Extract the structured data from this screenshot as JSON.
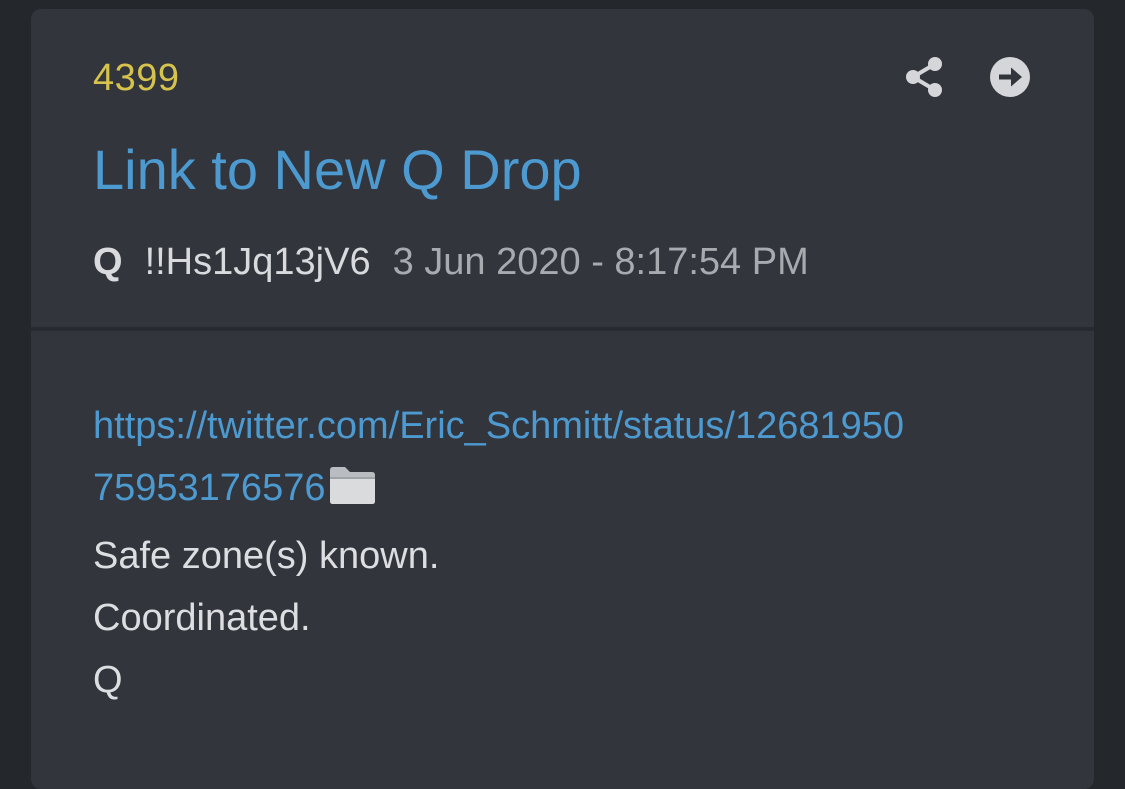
{
  "post": {
    "number": "4399",
    "title": "Link to New Q Drop",
    "author": "Q",
    "tripcode": "!!Hs1Jq13jV6",
    "date": "3 Jun 2020 - 8:17:54 PM",
    "link_line1": "https://twitter.com/Eric_Schmitt/status/12681950",
    "link_line2": "75953176576",
    "lines": [
      "Safe zone(s) known.",
      "Coordinated.",
      "Q"
    ]
  },
  "icons": {
    "share": "share-icon",
    "open": "arrow-right-circle-icon",
    "folder": "folder-icon"
  },
  "colors": {
    "background": "#24272c",
    "card": "#32353c",
    "number": "#d6c34d",
    "link": "#4d9ad1",
    "text": "#dcdee1",
    "muted": "#a7aaaf"
  }
}
